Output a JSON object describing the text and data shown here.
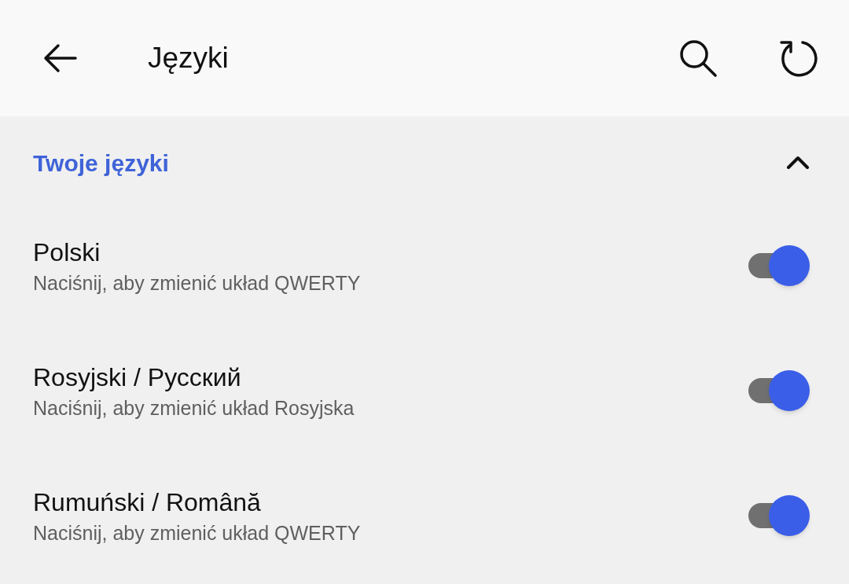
{
  "app_bar": {
    "title": "Języki"
  },
  "section": {
    "title": "Twoje języki",
    "expanded": true
  },
  "languages": [
    {
      "name": "Polski",
      "subtitle": "Naciśnij, aby zmienić układ QWERTY",
      "on": true
    },
    {
      "name": "Rosyjski / Русский",
      "subtitle": "Naciśnij, aby zmienić układ Rosyjska",
      "on": true
    },
    {
      "name": "Rumuński / Română",
      "subtitle": "Naciśnij, aby zmienić układ QWERTY",
      "on": true
    }
  ]
}
